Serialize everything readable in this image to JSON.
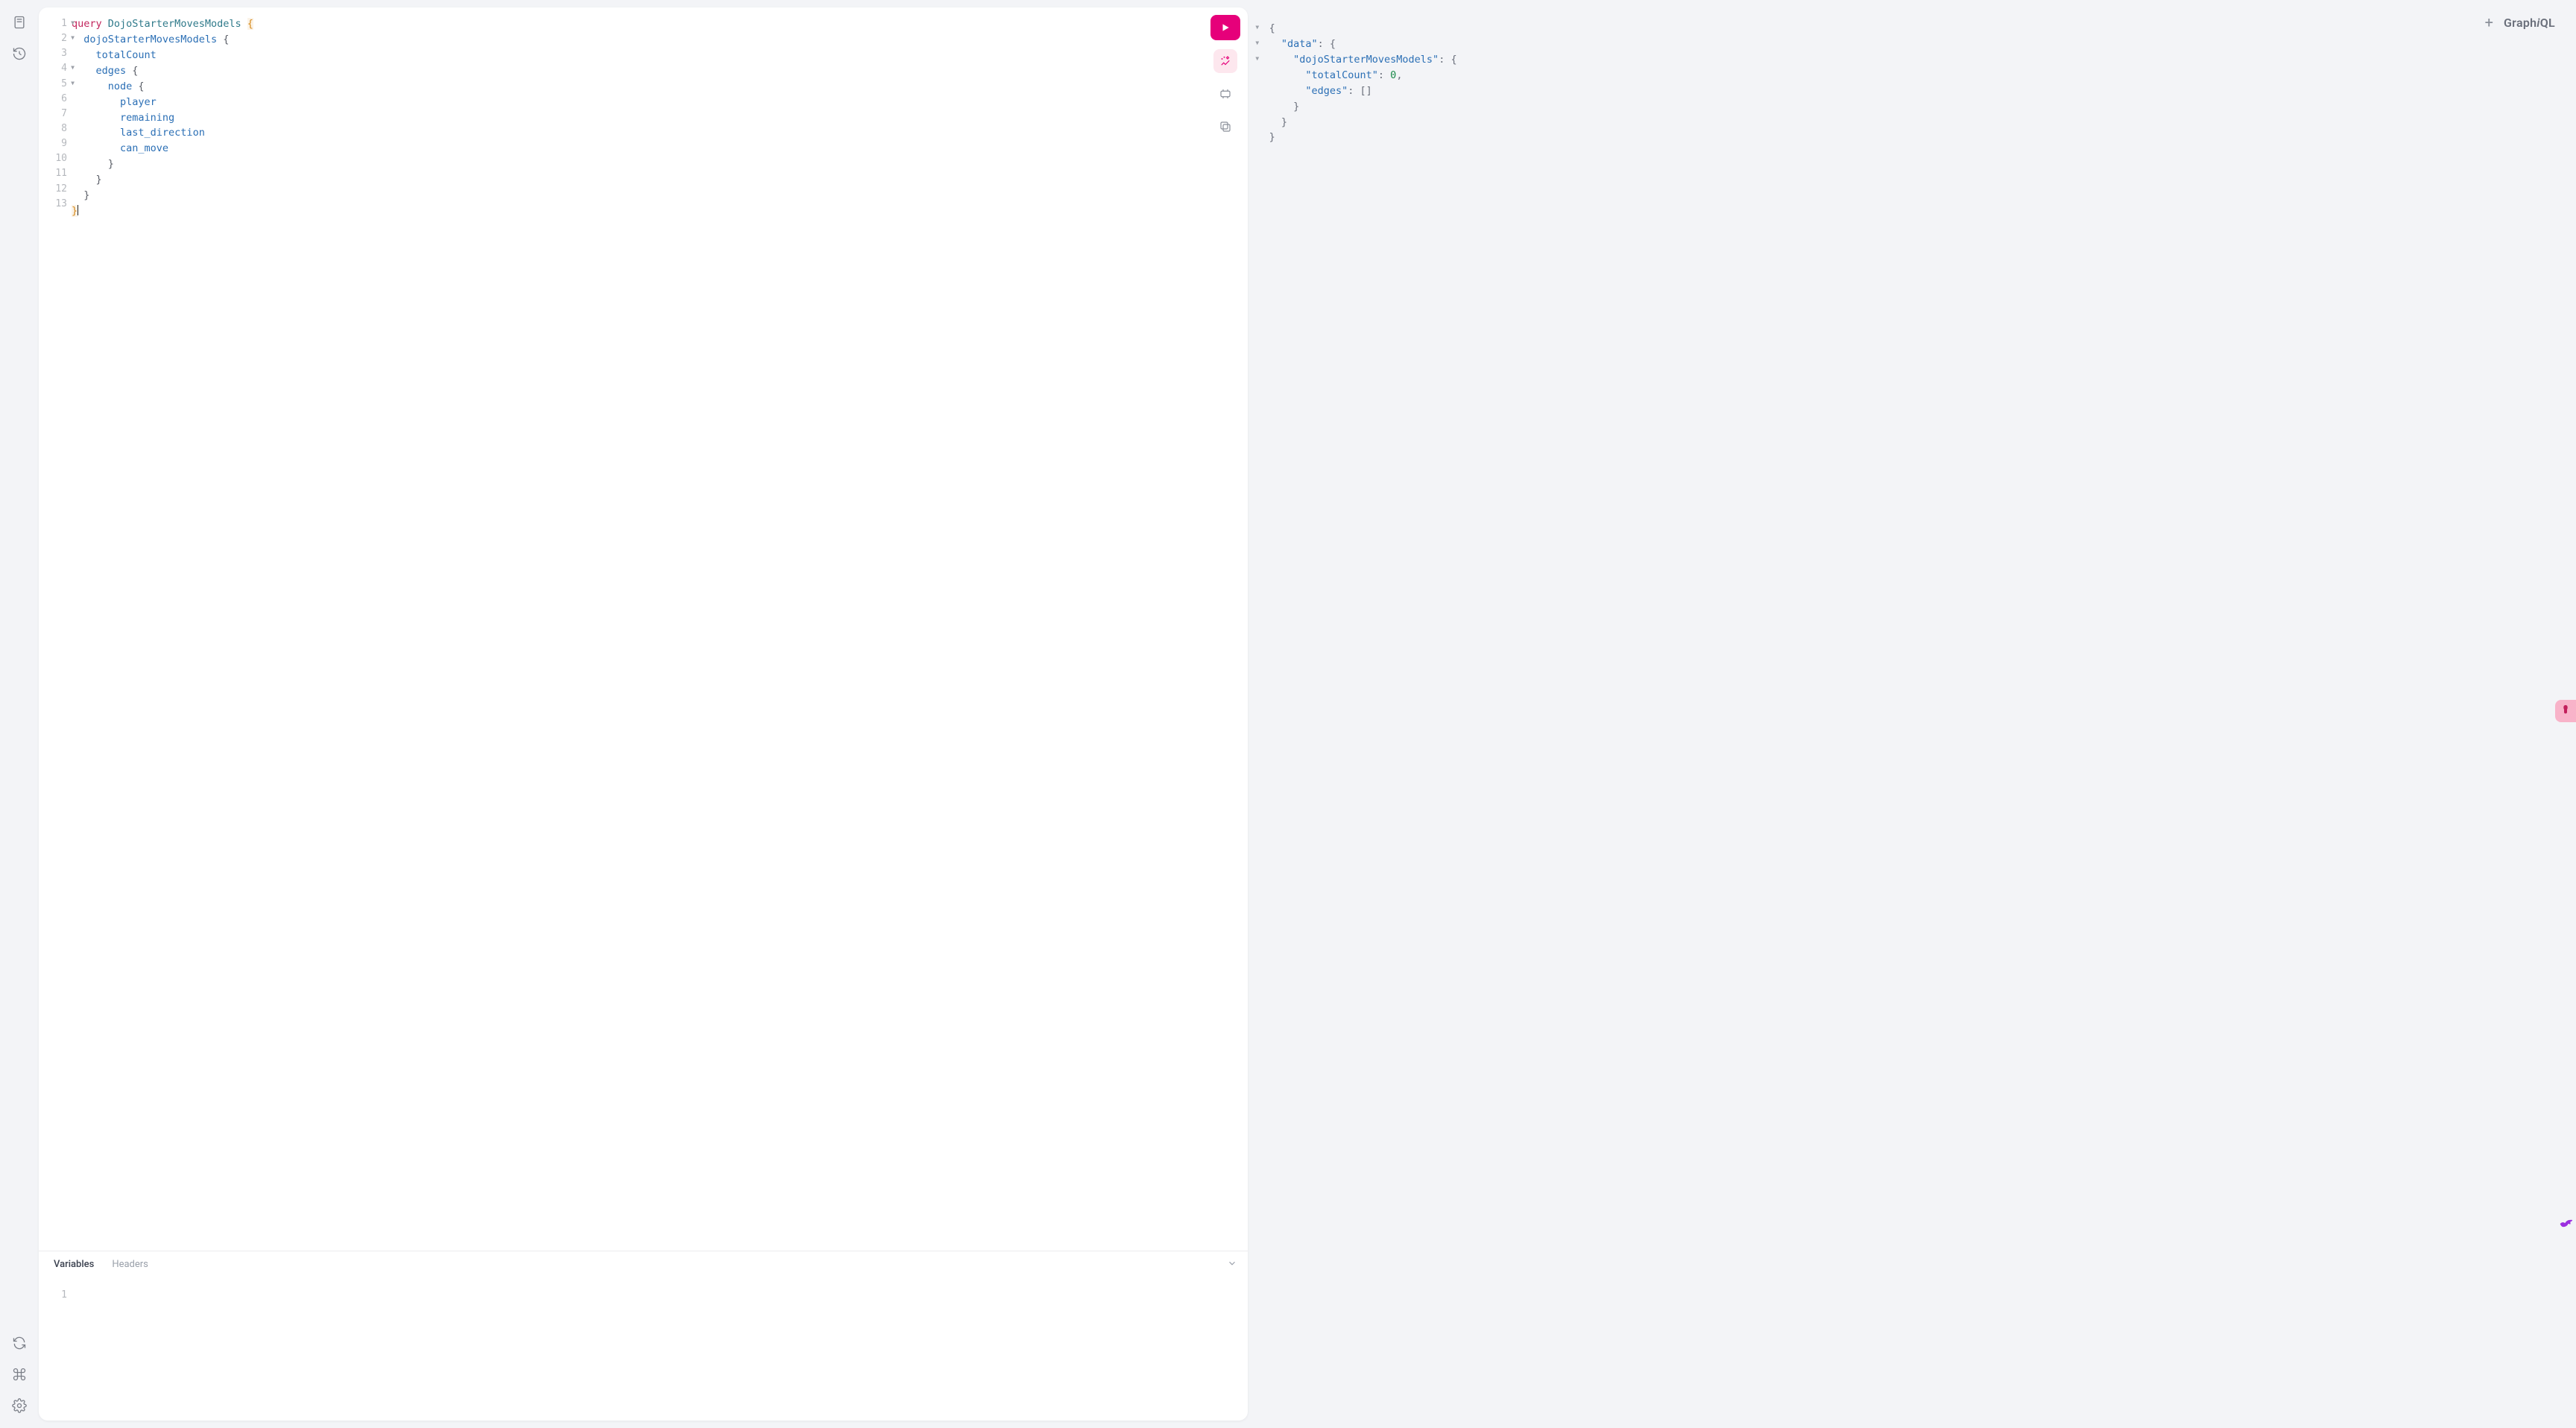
{
  "brand_prefix": "Graph",
  "brand_i": "i",
  "brand_suffix": "QL",
  "query_lines": [
    {
      "n": "1",
      "fold": true,
      "tokens": [
        {
          "t": "query ",
          "c": "tok-keyword"
        },
        {
          "t": "DojoStarterMovesModels ",
          "c": "tok-def"
        },
        {
          "t": "{",
          "c": "tok-brace-match"
        }
      ]
    },
    {
      "n": "2",
      "fold": true,
      "tokens": [
        {
          "t": "  ",
          "c": ""
        },
        {
          "t": "dojoStarterMovesModels ",
          "c": "tok-field"
        },
        {
          "t": "{",
          "c": "tok-brace"
        }
      ]
    },
    {
      "n": "3",
      "fold": false,
      "tokens": [
        {
          "t": "    ",
          "c": ""
        },
        {
          "t": "totalCount",
          "c": "tok-field"
        }
      ]
    },
    {
      "n": "4",
      "fold": true,
      "tokens": [
        {
          "t": "    ",
          "c": ""
        },
        {
          "t": "edges ",
          "c": "tok-field"
        },
        {
          "t": "{",
          "c": "tok-brace"
        }
      ]
    },
    {
      "n": "5",
      "fold": true,
      "tokens": [
        {
          "t": "      ",
          "c": ""
        },
        {
          "t": "node ",
          "c": "tok-field"
        },
        {
          "t": "{",
          "c": "tok-brace"
        }
      ]
    },
    {
      "n": "6",
      "fold": false,
      "tokens": [
        {
          "t": "        ",
          "c": ""
        },
        {
          "t": "player",
          "c": "tok-field"
        }
      ]
    },
    {
      "n": "7",
      "fold": false,
      "tokens": [
        {
          "t": "        ",
          "c": ""
        },
        {
          "t": "remaining",
          "c": "tok-field"
        }
      ]
    },
    {
      "n": "8",
      "fold": false,
      "tokens": [
        {
          "t": "        ",
          "c": ""
        },
        {
          "t": "last_direction",
          "c": "tok-field"
        }
      ]
    },
    {
      "n": "9",
      "fold": false,
      "tokens": [
        {
          "t": "        ",
          "c": ""
        },
        {
          "t": "can_move",
          "c": "tok-field"
        }
      ]
    },
    {
      "n": "10",
      "fold": false,
      "tokens": [
        {
          "t": "      ",
          "c": ""
        },
        {
          "t": "}",
          "c": "tok-brace"
        }
      ]
    },
    {
      "n": "11",
      "fold": false,
      "tokens": [
        {
          "t": "    ",
          "c": ""
        },
        {
          "t": "}",
          "c": "tok-brace"
        }
      ]
    },
    {
      "n": "12",
      "fold": false,
      "tokens": [
        {
          "t": "  ",
          "c": ""
        },
        {
          "t": "}",
          "c": "tok-brace"
        }
      ]
    },
    {
      "n": "13",
      "fold": false,
      "tokens": [
        {
          "t": "",
          "c": ""
        },
        {
          "t": "}",
          "c": "tok-brace-match"
        }
      ],
      "cursor": true
    }
  ],
  "tabs": {
    "variables": "Variables",
    "headers": "Headers",
    "active": "variables"
  },
  "variables_lines": [
    {
      "n": "1",
      "text": ""
    }
  ],
  "response_lines": [
    {
      "fold": true,
      "indent": 0,
      "tokens": [
        {
          "t": "{",
          "c": "jbr"
        }
      ]
    },
    {
      "fold": true,
      "indent": 1,
      "tokens": [
        {
          "t": "\"data\"",
          "c": "jkey"
        },
        {
          "t": ": ",
          "c": "jbr"
        },
        {
          "t": "{",
          "c": "jbr"
        }
      ]
    },
    {
      "fold": true,
      "indent": 2,
      "tokens": [
        {
          "t": "\"dojoStarterMovesModels\"",
          "c": "jkey"
        },
        {
          "t": ": ",
          "c": "jbr"
        },
        {
          "t": "{",
          "c": "jbr"
        }
      ]
    },
    {
      "fold": false,
      "indent": 3,
      "tokens": [
        {
          "t": "\"totalCount\"",
          "c": "jkey"
        },
        {
          "t": ": ",
          "c": "jbr"
        },
        {
          "t": "0",
          "c": "jnum"
        },
        {
          "t": ",",
          "c": "jbr"
        }
      ]
    },
    {
      "fold": false,
      "indent": 3,
      "tokens": [
        {
          "t": "\"edges\"",
          "c": "jkey"
        },
        {
          "t": ": ",
          "c": "jbr"
        },
        {
          "t": "[]",
          "c": "jbr"
        }
      ]
    },
    {
      "fold": false,
      "indent": 2,
      "tokens": [
        {
          "t": "}",
          "c": "jbr"
        }
      ]
    },
    {
      "fold": false,
      "indent": 1,
      "tokens": [
        {
          "t": "}",
          "c": "jbr"
        }
      ]
    },
    {
      "fold": false,
      "indent": 0,
      "tokens": [
        {
          "t": "}",
          "c": "jbr"
        }
      ]
    }
  ]
}
